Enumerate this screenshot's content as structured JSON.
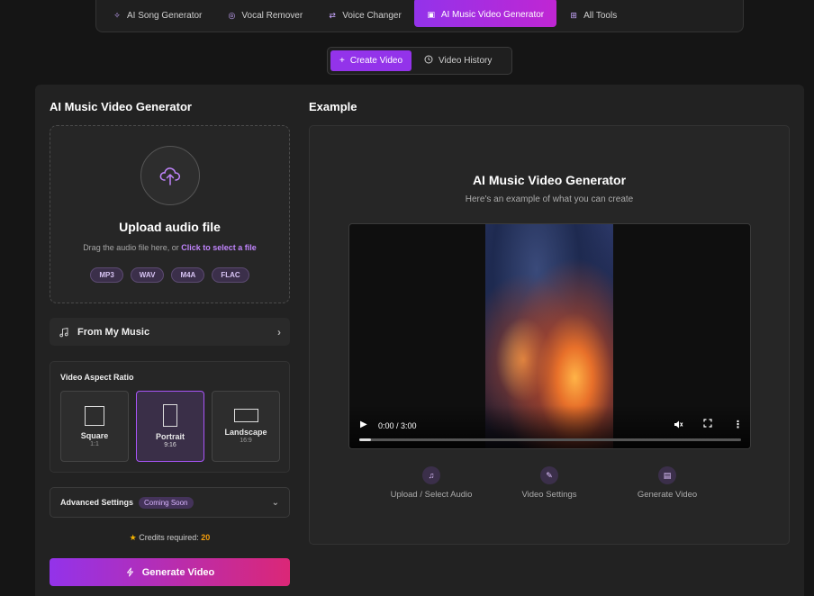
{
  "topnav": {
    "items": [
      {
        "label": "AI Song Generator",
        "icon": "sparkle-icon"
      },
      {
        "label": "Vocal Remover",
        "icon": "disc-icon"
      },
      {
        "label": "Voice Changer",
        "icon": "swap-icon"
      },
      {
        "label": "AI Music Video Generator",
        "icon": "film-icon",
        "active": true
      },
      {
        "label": "All Tools",
        "icon": "grid-icon"
      }
    ]
  },
  "modetabs": {
    "create": "Create Video",
    "history": "Video History"
  },
  "left": {
    "title": "AI Music Video Generator",
    "upload": {
      "title": "Upload audio file",
      "sub_prefix": "Drag the audio file here, or ",
      "sub_link": "Click to select a file",
      "formats": [
        "MP3",
        "WAV",
        "M4A",
        "FLAC"
      ]
    },
    "from_music": "From My Music",
    "aspect": {
      "title": "Video Aspect Ratio",
      "options": [
        {
          "label": "Square",
          "ratio": "1:1"
        },
        {
          "label": "Portrait",
          "ratio": "9:16",
          "selected": true
        },
        {
          "label": "Landscape",
          "ratio": "16:9"
        }
      ]
    },
    "advanced": {
      "label": "Advanced Settings",
      "badge": "Coming Soon"
    },
    "credits": {
      "label": "Credits required: ",
      "value": "20"
    },
    "generate": "Generate Video"
  },
  "example": {
    "section_title": "Example",
    "title": "AI Music Video Generator",
    "subtitle": "Here's an example of what you can create",
    "video": {
      "time": "0:00 / 3:00",
      "progress": 0.03
    },
    "steps": [
      {
        "label": "Upload / Select Audio",
        "icon": "music-note-icon"
      },
      {
        "label": "Video Settings",
        "icon": "palette-icon"
      },
      {
        "label": "Generate Video",
        "icon": "clapperboard-icon"
      }
    ]
  },
  "colors": {
    "accent": "#9333ea",
    "accent_pink": "#db2777",
    "credits": "#f59e0b"
  }
}
